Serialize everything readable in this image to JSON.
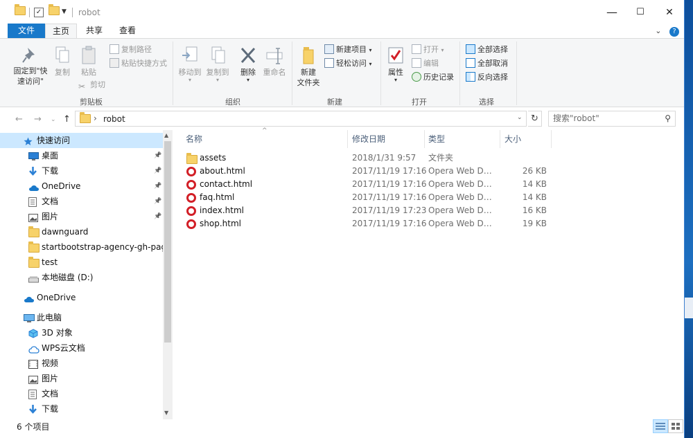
{
  "window": {
    "title": "robot",
    "controls": {
      "minimize": "—",
      "maximize": "☐",
      "close": "✕"
    }
  },
  "ribbon_tabs": [
    "文件",
    "主页",
    "共享",
    "查看"
  ],
  "ribbon": {
    "clipboard": {
      "pin_label": "固定到\"快速访问\"",
      "copy_label": "复制",
      "paste_label": "粘贴",
      "copy_path_label": "复制路径",
      "paste_shortcut_label": "粘贴快捷方式",
      "cut_label": "剪切",
      "group_label": "剪贴板"
    },
    "organize": {
      "move_to_label": "移动到",
      "copy_to_label": "复制到",
      "delete_label": "删除",
      "rename_label": "重命名",
      "group_label": "组织"
    },
    "new": {
      "new_folder_label": "新建\n文件夹",
      "new_item_label": "新建项目",
      "easy_access_label": "轻松访问",
      "group_label": "新建"
    },
    "open": {
      "properties_label": "属性",
      "open_label": "打开",
      "edit_label": "编辑",
      "history_label": "历史记录",
      "group_label": "打开"
    },
    "select": {
      "select_all_label": "全部选择",
      "select_none_label": "全部取消",
      "invert_label": "反向选择",
      "group_label": "选择"
    }
  },
  "address": {
    "path": "robot",
    "search_placeholder": "搜索\"robot\""
  },
  "nav_pane": [
    {
      "label": "快速访问",
      "icon": "star-icon",
      "level": 0,
      "selected": true
    },
    {
      "label": "桌面",
      "icon": "desktop-icon",
      "level": 1,
      "pinned": true
    },
    {
      "label": "下载",
      "icon": "download-icon",
      "level": 1,
      "pinned": true
    },
    {
      "label": "OneDrive",
      "icon": "cloud-icon",
      "level": 1,
      "pinned": true
    },
    {
      "label": "文档",
      "icon": "document-icon",
      "level": 1,
      "pinned": true
    },
    {
      "label": "图片",
      "icon": "picture-icon",
      "level": 1,
      "pinned": true
    },
    {
      "label": "dawnguard",
      "icon": "folder-icon",
      "level": 1
    },
    {
      "label": "startbootstrap-agency-gh-pages",
      "icon": "folder-icon",
      "level": 1
    },
    {
      "label": "test",
      "icon": "folder-icon",
      "level": 1
    },
    {
      "label": "本地磁盘 (D:)",
      "icon": "drive-icon",
      "level": 1
    },
    {
      "label": "OneDrive",
      "icon": "cloud-icon",
      "level": 0
    },
    {
      "label": "此电脑",
      "icon": "computer-icon",
      "level": 0
    },
    {
      "label": "3D 对象",
      "icon": "cube-icon",
      "level": 1
    },
    {
      "label": "WPS云文档",
      "icon": "cloud-doc-icon",
      "level": 1
    },
    {
      "label": "视频",
      "icon": "video-icon",
      "level": 1
    },
    {
      "label": "图片",
      "icon": "picture-icon",
      "level": 1
    },
    {
      "label": "文档",
      "icon": "document-icon",
      "level": 1
    },
    {
      "label": "下载",
      "icon": "download-icon",
      "level": 1
    }
  ],
  "columns": {
    "name": "名称",
    "date": "修改日期",
    "type": "类型",
    "size": "大小"
  },
  "files": [
    {
      "name": "assets",
      "date": "2018/1/31 9:57",
      "type": "文件夹",
      "size": "",
      "icon": "folder-icon"
    },
    {
      "name": "about.html",
      "date": "2017/11/19 17:16",
      "type": "Opera Web Doc...",
      "size": "26 KB",
      "icon": "opera-icon"
    },
    {
      "name": "contact.html",
      "date": "2017/11/19 17:16",
      "type": "Opera Web Doc...",
      "size": "14 KB",
      "icon": "opera-icon"
    },
    {
      "name": "faq.html",
      "date": "2017/11/19 17:16",
      "type": "Opera Web Doc...",
      "size": "14 KB",
      "icon": "opera-icon"
    },
    {
      "name": "index.html",
      "date": "2017/11/19 17:23",
      "type": "Opera Web Doc...",
      "size": "16 KB",
      "icon": "opera-icon"
    },
    {
      "name": "shop.html",
      "date": "2017/11/19 17:16",
      "type": "Opera Web Doc...",
      "size": "19 KB",
      "icon": "opera-icon"
    }
  ],
  "status": {
    "item_count": "6 个项目"
  },
  "colors": {
    "accent": "#1979ca",
    "selection": "#cce8ff",
    "folder": "#f7d26a",
    "opera": "#d21f27"
  }
}
